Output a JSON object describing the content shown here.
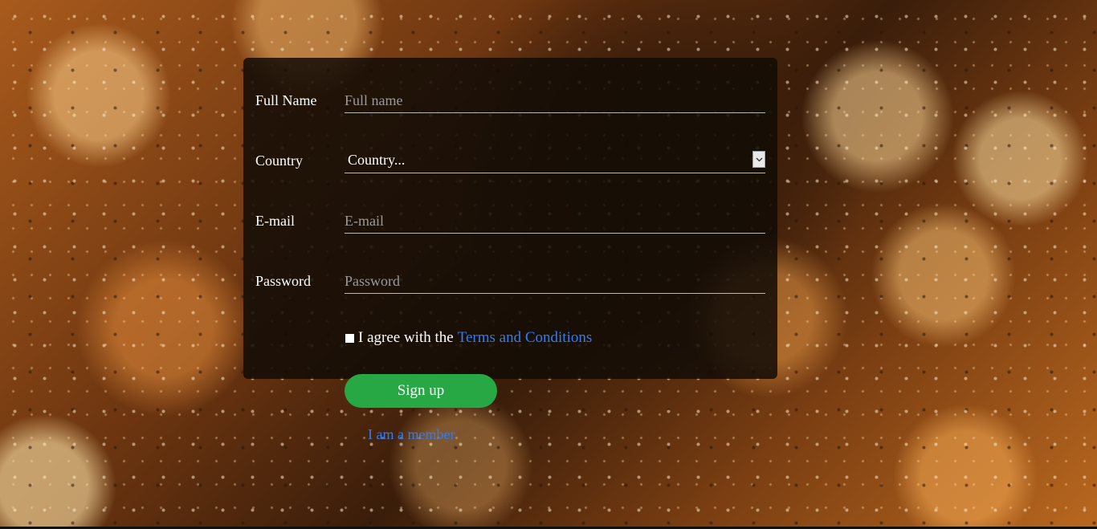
{
  "form": {
    "full_name": {
      "label": "Full Name",
      "placeholder": "Full name",
      "value": ""
    },
    "country": {
      "label": "Country",
      "selected": "Country..."
    },
    "email": {
      "label": "E-mail",
      "placeholder": "E-mail",
      "value": ""
    },
    "password": {
      "label": "Password",
      "placeholder": "Password",
      "value": ""
    },
    "agree": {
      "prefix": "I agree with the",
      "link": "Terms and Conditions",
      "checked": false
    },
    "signup_label": "Sign up",
    "member_link": "I am a member"
  },
  "colors": {
    "accent_button": "#28a745",
    "link": "#2f7df6"
  },
  "icons": {
    "select_arrow": "chevron-down-icon"
  }
}
